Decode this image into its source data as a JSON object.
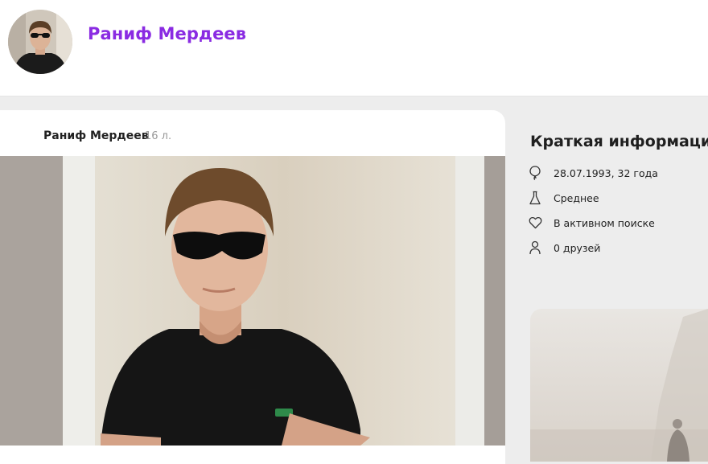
{
  "profile": {
    "name": "Раниф Мердеев"
  },
  "post": {
    "author": "Раниф Мердеев",
    "age": "16 л."
  },
  "info": {
    "title": "Краткая информация",
    "items": [
      {
        "icon": "balloon-icon",
        "text": "28.07.1993, 32 года"
      },
      {
        "icon": "flask-icon",
        "text": "Среднее"
      },
      {
        "icon": "heart-icon",
        "text": "В активном поиске"
      },
      {
        "icon": "person-icon",
        "text": "0 друзей"
      }
    ]
  },
  "colors": {
    "accent": "#8a2be2",
    "page_bg": "#ededed",
    "card_bg": "#ffffff",
    "muted": "#9a9a9a"
  }
}
